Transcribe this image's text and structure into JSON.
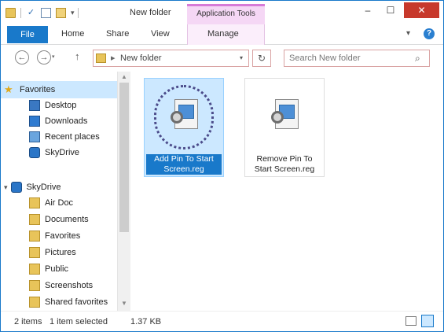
{
  "window": {
    "title": "New folder",
    "context_tab_title": "Application Tools",
    "minimize": "–",
    "maximize": "☐",
    "close": "✕"
  },
  "qat": {
    "check_glyph": "✓",
    "dropdown_glyph": "▾"
  },
  "ribbon": {
    "tabs": [
      {
        "label": "File",
        "active": true
      },
      {
        "label": "Home"
      },
      {
        "label": "Share"
      },
      {
        "label": "View"
      },
      {
        "label": "Manage"
      }
    ],
    "expand_glyph": "▾",
    "help_glyph": "?"
  },
  "address": {
    "back_glyph": "←",
    "forward_glyph": "→",
    "forward_drop_glyph": "▾",
    "up_glyph": "↑",
    "chevron_glyph": "▸",
    "path": "New folder",
    "dropdown_glyph": "▾",
    "refresh_glyph": "↻"
  },
  "search": {
    "placeholder": "Search New folder",
    "icon_glyph": "⌕"
  },
  "nav": {
    "favorites_label": "Favorites",
    "favorites_items": [
      "Desktop",
      "Downloads",
      "Recent places",
      "SkyDrive"
    ],
    "skydrive_label": "SkyDrive",
    "skydrive_items": [
      "Air Doc",
      "Documents",
      "Favorites",
      "Pictures",
      "Public",
      "Screenshots",
      "Shared favorites"
    ],
    "expand_glyph": "▾",
    "star_glyph": "★"
  },
  "scrollbar": {
    "up_glyph": "▲",
    "down_glyph": "▼"
  },
  "files": [
    {
      "name": "Add Pin To Start Screen.reg",
      "selected": true
    },
    {
      "name": "Remove Pin To Start Screen.reg",
      "selected": false
    }
  ],
  "status": {
    "items": "2 items",
    "selected": "1 item selected",
    "size": "1.37 KB"
  },
  "colors": {
    "accent": "#1979ca",
    "selection": "#cce8ff",
    "close": "#c7392c",
    "context_tab": "#f5d7f5"
  }
}
